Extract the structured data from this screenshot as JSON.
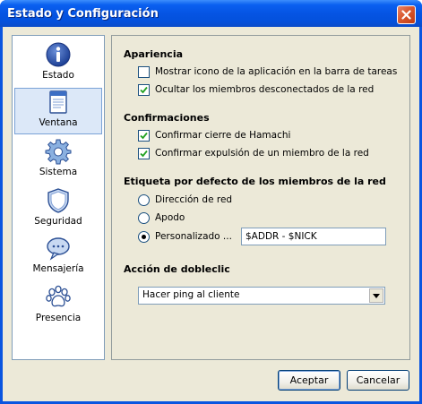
{
  "window": {
    "title": "Estado y Configuración"
  },
  "sidebar": {
    "items": [
      {
        "label": "Estado",
        "icon": "info-icon",
        "selected": false
      },
      {
        "label": "Ventana",
        "icon": "window-icon",
        "selected": true
      },
      {
        "label": "Sistema",
        "icon": "gear-icon",
        "selected": false
      },
      {
        "label": "Seguridad",
        "icon": "shield-icon",
        "selected": false
      },
      {
        "label": "Mensajería",
        "icon": "chat-bubble-icon",
        "selected": false
      },
      {
        "label": "Presencia",
        "icon": "paw-icon",
        "selected": false
      }
    ]
  },
  "panel": {
    "apariencia": {
      "title": "Apariencia",
      "options": [
        {
          "label": "Mostrar icono de la aplicación en la barra de tareas",
          "checked": false
        },
        {
          "label": "Ocultar los miembros desconectados de la red",
          "checked": true
        }
      ]
    },
    "confirmaciones": {
      "title": "Confirmaciones",
      "options": [
        {
          "label": "Confirmar cierre de Hamachi",
          "checked": true
        },
        {
          "label": "Confirmar expulsión de un miembro de la red",
          "checked": true
        }
      ]
    },
    "etiqueta": {
      "title": "Etiqueta por defecto de los miembros de la red",
      "options": [
        {
          "label": "Dirección de red",
          "selected": false
        },
        {
          "label": "Apodo",
          "selected": false
        },
        {
          "label": "Personalizado ...",
          "selected": true
        }
      ],
      "custom_value": "$ADDR - $NICK"
    },
    "dobleclic": {
      "title": "Acción de dobleclic",
      "selected_value": "Hacer ping al cliente"
    }
  },
  "buttons": {
    "accept": "Aceptar",
    "cancel": "Cancelar"
  }
}
